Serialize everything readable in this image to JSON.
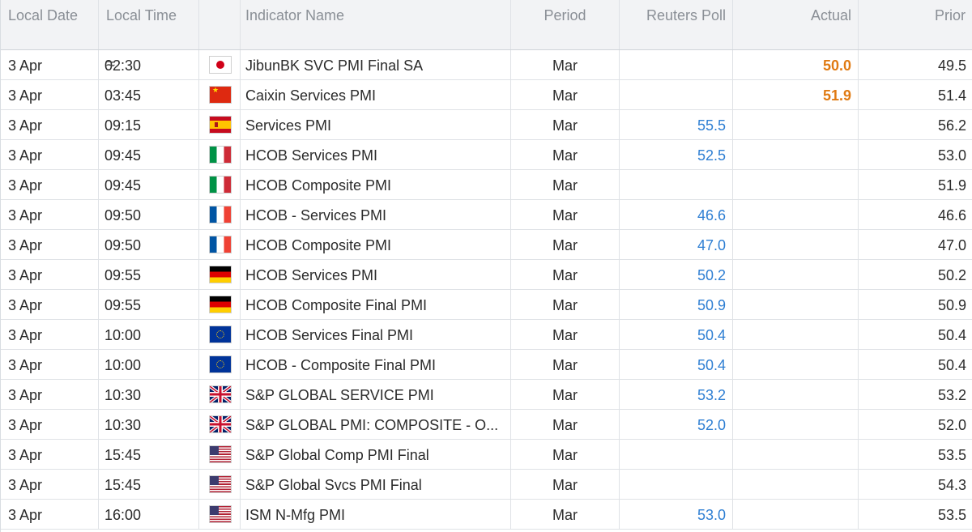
{
  "headers": {
    "local_date": "Local Date",
    "local_time": "Local Time",
    "flag": "",
    "indicator_name": "Indicator Name",
    "period": "Period",
    "reuters_poll": "Reuters Poll",
    "actual": "Actual",
    "prior": "Prior"
  },
  "rows": [
    {
      "date": "3 Apr",
      "time": "02:30",
      "approx": "≈",
      "flag": "japan-flag",
      "flag_class": "f-jp",
      "name": "JibunBK SVC PMI Final SA",
      "period": "Mar",
      "poll": "",
      "actual": "50.0",
      "prior": "49.5"
    },
    {
      "date": "3 Apr",
      "time": "03:45",
      "approx": "",
      "flag": "china-flag",
      "flag_class": "f-cn",
      "name": "Caixin Services PMI",
      "period": "Mar",
      "poll": "",
      "actual": "51.9",
      "prior": "51.4"
    },
    {
      "date": "3 Apr",
      "time": "09:15",
      "approx": "",
      "flag": "spain-flag",
      "flag_class": "f-es",
      "name": "Services PMI",
      "period": "Mar",
      "poll": "55.5",
      "actual": "",
      "prior": "56.2"
    },
    {
      "date": "3 Apr",
      "time": "09:45",
      "approx": "",
      "flag": "italy-flag",
      "flag_class": "f-it",
      "name": "HCOB Services PMI",
      "period": "Mar",
      "poll": "52.5",
      "actual": "",
      "prior": "53.0"
    },
    {
      "date": "3 Apr",
      "time": "09:45",
      "approx": "",
      "flag": "italy-flag",
      "flag_class": "f-it",
      "name": "HCOB Composite PMI",
      "period": "Mar",
      "poll": "",
      "actual": "",
      "prior": "51.9"
    },
    {
      "date": "3 Apr",
      "time": "09:50",
      "approx": "",
      "flag": "france-flag",
      "flag_class": "f-fr",
      "name": "HCOB - Services PMI",
      "period": "Mar",
      "poll": "46.6",
      "actual": "",
      "prior": "46.6"
    },
    {
      "date": "3 Apr",
      "time": "09:50",
      "approx": "",
      "flag": "france-flag",
      "flag_class": "f-fr",
      "name": "HCOB Composite PMI",
      "period": "Mar",
      "poll": "47.0",
      "actual": "",
      "prior": "47.0"
    },
    {
      "date": "3 Apr",
      "time": "09:55",
      "approx": "",
      "flag": "germany-flag",
      "flag_class": "f-de",
      "name": "HCOB Services PMI",
      "period": "Mar",
      "poll": "50.2",
      "actual": "",
      "prior": "50.2"
    },
    {
      "date": "3 Apr",
      "time": "09:55",
      "approx": "",
      "flag": "germany-flag",
      "flag_class": "f-de",
      "name": "HCOB Composite Final PMI",
      "period": "Mar",
      "poll": "50.9",
      "actual": "",
      "prior": "50.9"
    },
    {
      "date": "3 Apr",
      "time": "10:00",
      "approx": "",
      "flag": "eu-flag",
      "flag_class": "f-eu",
      "name": "HCOB Services Final PMI",
      "period": "Mar",
      "poll": "50.4",
      "actual": "",
      "prior": "50.4"
    },
    {
      "date": "3 Apr",
      "time": "10:00",
      "approx": "",
      "flag": "eu-flag",
      "flag_class": "f-eu",
      "name": "HCOB - Composite Final PMI",
      "period": "Mar",
      "poll": "50.4",
      "actual": "",
      "prior": "50.4"
    },
    {
      "date": "3 Apr",
      "time": "10:30",
      "approx": "",
      "flag": "uk-flag",
      "flag_class": "f-gb",
      "name": "S&P GLOBAL SERVICE PMI",
      "period": "Mar",
      "poll": "53.2",
      "actual": "",
      "prior": "53.2"
    },
    {
      "date": "3 Apr",
      "time": "10:30",
      "approx": "",
      "flag": "uk-flag",
      "flag_class": "f-gb",
      "name": "S&P GLOBAL PMI: COMPOSITE - O...",
      "period": "Mar",
      "poll": "52.0",
      "actual": "",
      "prior": "52.0"
    },
    {
      "date": "3 Apr",
      "time": "15:45",
      "approx": "",
      "flag": "usa-flag",
      "flag_class": "f-us",
      "name": "S&P Global Comp PMI Final",
      "period": "Mar",
      "poll": "",
      "actual": "",
      "prior": "53.5"
    },
    {
      "date": "3 Apr",
      "time": "15:45",
      "approx": "",
      "flag": "usa-flag",
      "flag_class": "f-us",
      "name": "S&P Global Svcs PMI Final",
      "period": "Mar",
      "poll": "",
      "actual": "",
      "prior": "54.3"
    },
    {
      "date": "3 Apr",
      "time": "16:00",
      "approx": "",
      "flag": "usa-flag",
      "flag_class": "f-us",
      "name": "ISM N-Mfg PMI",
      "period": "Mar",
      "poll": "53.0",
      "actual": "",
      "prior": "53.5"
    }
  ],
  "colors": {
    "header_bg": "#f2f3f5",
    "header_text": "#8a8f96",
    "poll_text": "#2f7fd3",
    "actual_text": "#e07a12",
    "grid_line": "#dfe2e6"
  }
}
